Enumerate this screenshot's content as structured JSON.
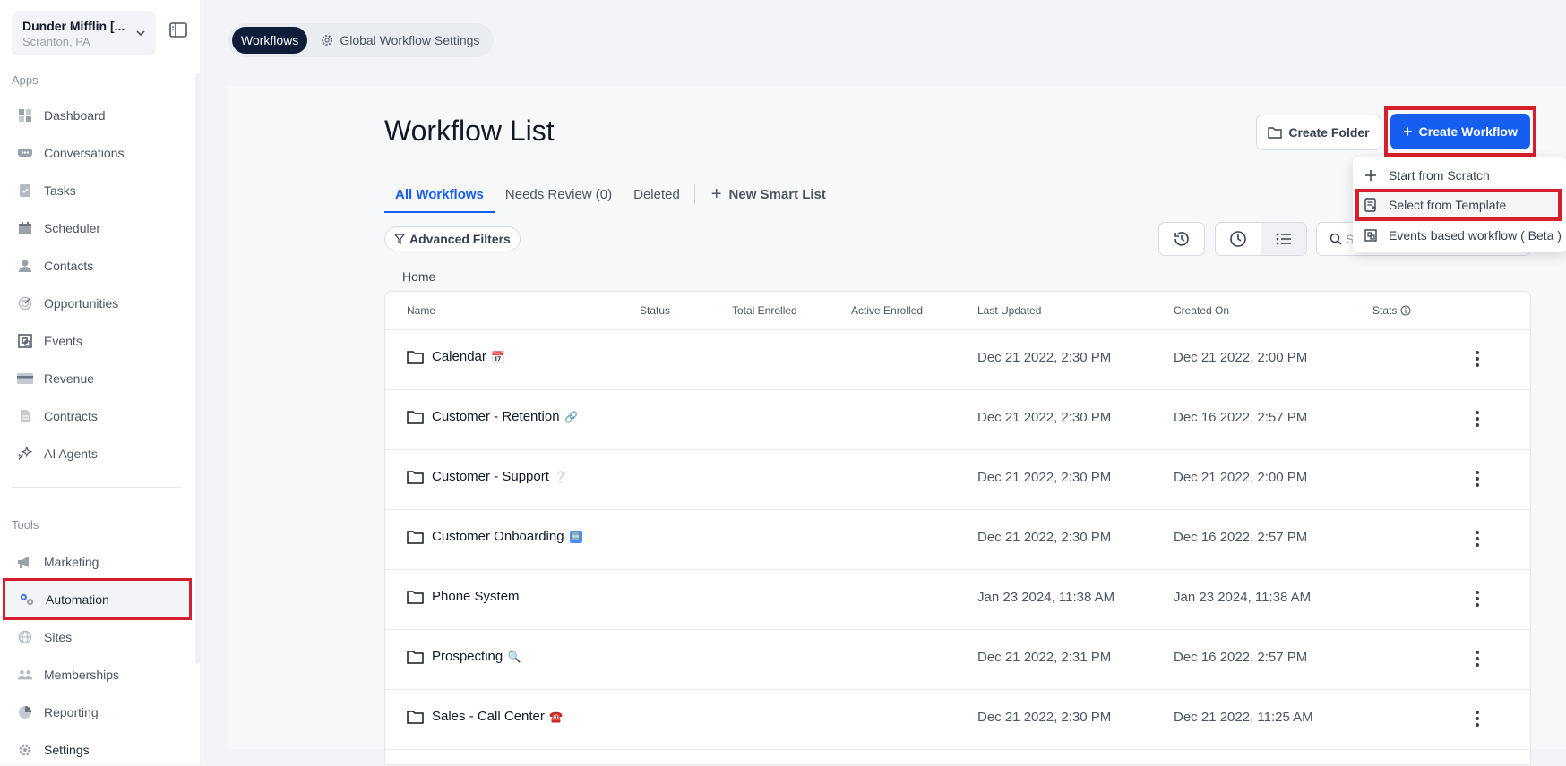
{
  "account": {
    "name": "Dunder Mifflin [...",
    "location": "Scranton, PA"
  },
  "sidebar": {
    "apps_label": "Apps",
    "tools_label": "Tools",
    "apps": [
      {
        "label": "Dashboard",
        "icon": "dashboard-icon"
      },
      {
        "label": "Conversations",
        "icon": "conversations-icon"
      },
      {
        "label": "Tasks",
        "icon": "tasks-icon"
      },
      {
        "label": "Scheduler",
        "icon": "calendar-icon"
      },
      {
        "label": "Contacts",
        "icon": "person-icon"
      },
      {
        "label": "Opportunities",
        "icon": "target-icon"
      },
      {
        "label": "Events",
        "icon": "events-icon"
      },
      {
        "label": "Revenue",
        "icon": "credit-card-icon"
      },
      {
        "label": "Contracts",
        "icon": "document-icon"
      },
      {
        "label": "AI Agents",
        "icon": "sparkle-icon"
      }
    ],
    "tools": [
      {
        "label": "Marketing",
        "icon": "megaphone-icon"
      },
      {
        "label": "Automation",
        "icon": "gears-icon",
        "active": true
      },
      {
        "label": "Sites",
        "icon": "globe-icon"
      },
      {
        "label": "Memberships",
        "icon": "people-icon"
      },
      {
        "label": "Reporting",
        "icon": "pie-chart-icon"
      },
      {
        "label": "Settings",
        "icon": "gear-icon"
      }
    ]
  },
  "topbar": {
    "workflows": "Workflows",
    "global_settings": "Global Workflow Settings"
  },
  "page": {
    "title": "Workflow List",
    "create_folder": "Create Folder",
    "create_workflow": "Create Workflow",
    "tabs": [
      "All Workflows",
      "Needs Review (0)",
      "Deleted"
    ],
    "new_smart_list": "New Smart List",
    "advanced_filters": "Advanced Filters",
    "search_placeholder": "S",
    "breadcrumb": "Home"
  },
  "dropdown": {
    "items": [
      {
        "label": "Start from Scratch",
        "icon": "plus-icon"
      },
      {
        "label": "Select from Template",
        "icon": "template-icon",
        "highlighted": true
      },
      {
        "label": "Events based workflow ( Beta )",
        "icon": "events-workflow-icon"
      }
    ]
  },
  "table": {
    "columns": [
      "Name",
      "Status",
      "Total Enrolled",
      "Active Enrolled",
      "Last Updated",
      "Created On",
      "Stats"
    ],
    "rows": [
      {
        "name": "Calendar",
        "emoji": "📅",
        "last_updated": "Dec 21 2022, 2:30 PM",
        "created_on": "Dec 21 2022, 2:00 PM"
      },
      {
        "name": "Customer - Retention",
        "emoji": "🔗",
        "last_updated": "Dec 21 2022, 2:30 PM",
        "created_on": "Dec 16 2022, 2:57 PM"
      },
      {
        "name": "Customer - Support",
        "emoji": "❔",
        "last_updated": "Dec 21 2022, 2:30 PM",
        "created_on": "Dec 21 2022, 2:00 PM"
      },
      {
        "name": "Customer Onboarding",
        "emoji": "🆕",
        "last_updated": "Dec 21 2022, 2:30 PM",
        "created_on": "Dec 16 2022, 2:57 PM"
      },
      {
        "name": "Phone System",
        "emoji": "",
        "last_updated": "Jan 23 2024, 11:38 AM",
        "created_on": "Jan 23 2024, 11:38 AM"
      },
      {
        "name": "Prospecting",
        "emoji": "🔍",
        "last_updated": "Dec 21 2022, 2:31 PM",
        "created_on": "Dec 16 2022, 2:57 PM"
      },
      {
        "name": "Sales - Call Center",
        "emoji": "☎️",
        "last_updated": "Dec 21 2022, 2:30 PM",
        "created_on": "Dec 21 2022, 11:25 AM"
      }
    ]
  },
  "colors": {
    "accent": "#155eef",
    "highlight": "#d61f2c",
    "nav_dark": "#0f1d3a"
  }
}
